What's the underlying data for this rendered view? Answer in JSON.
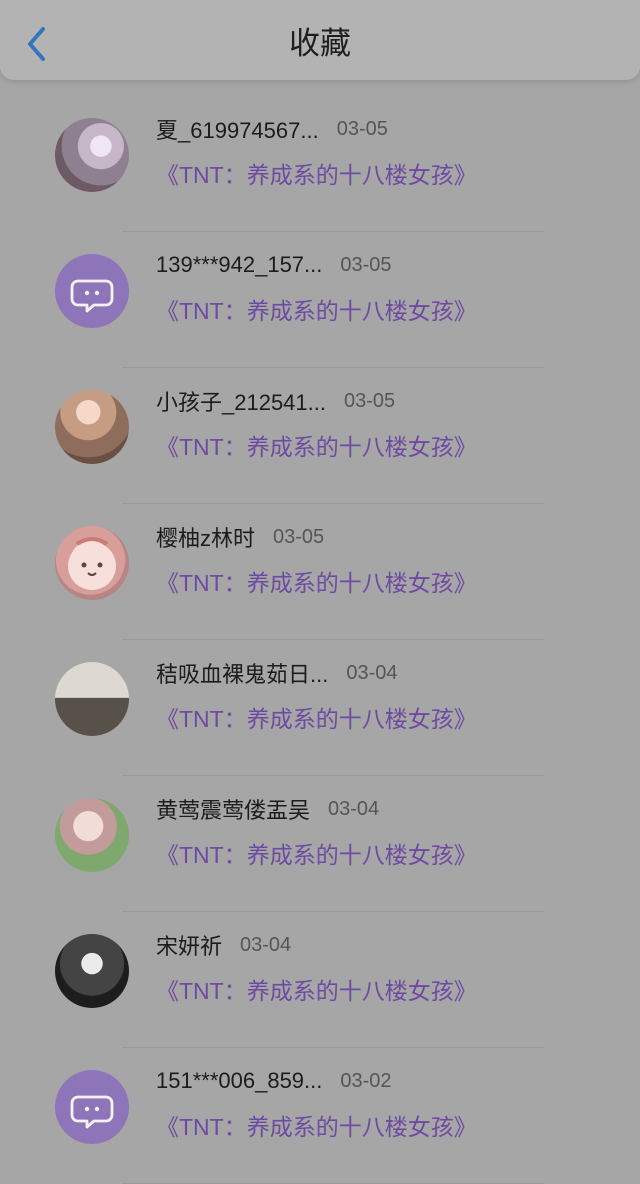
{
  "header": {
    "title": "收藏",
    "back_icon": "chevron-left-icon"
  },
  "list": [
    {
      "name": "夏_619974567...",
      "date": "03-05",
      "work": "《TNT：养成系的十八楼女孩》",
      "avatar": "photo"
    },
    {
      "name": "139***942_157...",
      "date": "03-05",
      "work": "《TNT：养成系的十八楼女孩》",
      "avatar": "chat-bubble-icon"
    },
    {
      "name": "小孩子_212541...",
      "date": "03-05",
      "work": "《TNT：养成系的十八楼女孩》",
      "avatar": "photo"
    },
    {
      "name": "樱柚z林时",
      "date": "03-05",
      "work": "《TNT：养成系的十八楼女孩》",
      "avatar": "cartoon-avatar-icon"
    },
    {
      "name": "秸吸血裸鬼茹日...",
      "date": "03-04",
      "work": "《TNT：养成系的十八楼女孩》",
      "avatar": "photo"
    },
    {
      "name": "黄莺震莺偻盂吴",
      "date": "03-04",
      "work": "《TNT：养成系的十八楼女孩》",
      "avatar": "photo"
    },
    {
      "name": "宋妍祈",
      "date": "03-04",
      "work": "《TNT：养成系的十八楼女孩》",
      "avatar": "photo"
    },
    {
      "name": "151***006_859...",
      "date": "03-02",
      "work": "《TNT：养成系的十八楼女孩》",
      "avatar": "chat-bubble-icon"
    }
  ]
}
